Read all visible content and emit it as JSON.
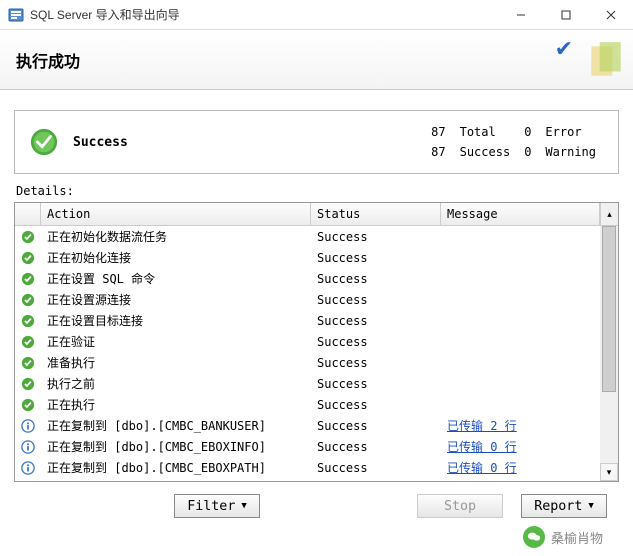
{
  "window": {
    "title": "SQL Server 导入和导出向导"
  },
  "header": {
    "title": "执行成功"
  },
  "summary": {
    "label": "Success",
    "stats": {
      "total_n": "87",
      "total_l": "Total",
      "error_n": "0",
      "error_l": "Error",
      "success_n": "87",
      "success_l": "Success",
      "warning_n": "0",
      "warning_l": "Warning"
    }
  },
  "details_label": "Details:",
  "columns": {
    "action": "Action",
    "status": "Status",
    "message": "Message"
  },
  "rows": [
    {
      "icon": "ok",
      "action": "正在初始化数据流任务",
      "status": "Success",
      "message": ""
    },
    {
      "icon": "ok",
      "action": "正在初始化连接",
      "status": "Success",
      "message": ""
    },
    {
      "icon": "ok",
      "action": "正在设置 SQL 命令",
      "status": "Success",
      "message": ""
    },
    {
      "icon": "ok",
      "action": "正在设置源连接",
      "status": "Success",
      "message": ""
    },
    {
      "icon": "ok",
      "action": "正在设置目标连接",
      "status": "Success",
      "message": ""
    },
    {
      "icon": "ok",
      "action": "正在验证",
      "status": "Success",
      "message": ""
    },
    {
      "icon": "ok",
      "action": "准备执行",
      "status": "Success",
      "message": ""
    },
    {
      "icon": "ok",
      "action": "执行之前",
      "status": "Success",
      "message": ""
    },
    {
      "icon": "ok",
      "action": "正在执行",
      "status": "Success",
      "message": ""
    },
    {
      "icon": "info",
      "action": "正在复制到 [dbo].[CMBC_BANKUSER]",
      "status": "Success",
      "message": "已传输 2 行"
    },
    {
      "icon": "info",
      "action": "正在复制到 [dbo].[CMBC_EBOXINFO]",
      "status": "Success",
      "message": "已传输 0 行"
    },
    {
      "icon": "info",
      "action": "正在复制到 [dbo].[CMBC_EBOXPATH]",
      "status": "Success",
      "message": "已传输 0 行"
    }
  ],
  "buttons": {
    "filter": "Filter",
    "stop": "Stop",
    "report": "Report"
  },
  "watermark": "桑榆肖物"
}
